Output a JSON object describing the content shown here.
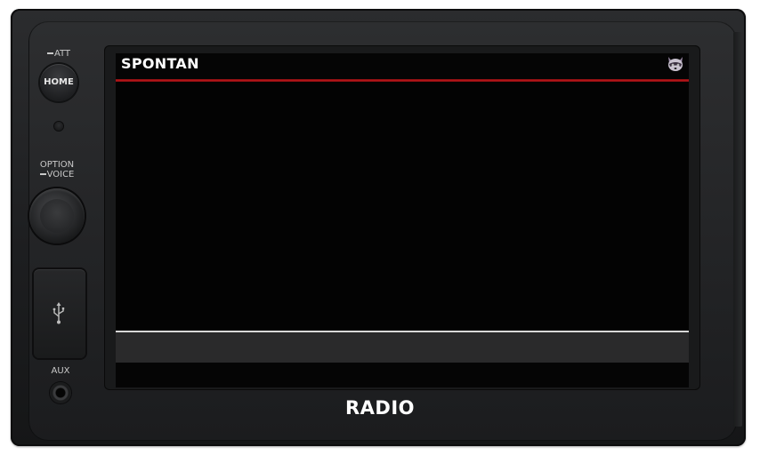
{
  "display": {
    "station_name": "SPONTAN",
    "mascot_icon": "raccoon-icon",
    "accent_color": "#c0161a"
  },
  "brand": {
    "label": "RADIO"
  },
  "controls": {
    "att_label": "ATT",
    "home_label": "HOME",
    "option_label": "OPTION",
    "voice_label": "VOICE",
    "usb_icon": "usb-icon",
    "aux_label": "AUX"
  }
}
